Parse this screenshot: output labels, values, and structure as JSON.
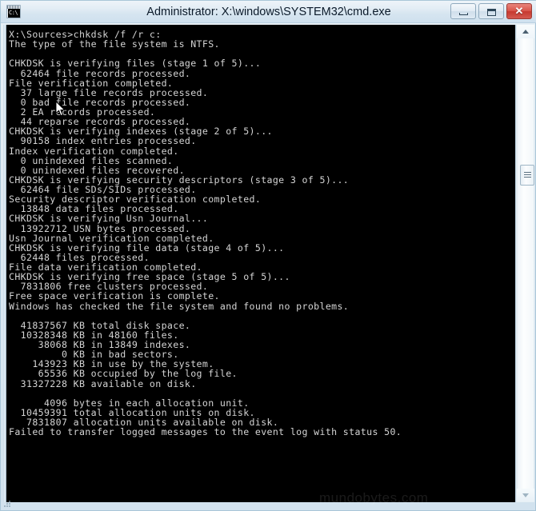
{
  "window": {
    "title": "Administrator: X:\\windows\\SYSTEM32\\cmd.exe",
    "app_icon": "cmd-console-icon",
    "icon_prompt_text": "C:\\",
    "colors": {
      "titlebar_top": "#eef4f9",
      "titlebar_bottom": "#cfe0ee",
      "frame_border": "#a9c6d8",
      "console_background": "#000000",
      "console_foreground": "#d4d4d4",
      "close_button": "#c6392f"
    },
    "caption_buttons": [
      {
        "name": "minimize",
        "label": "Minimize",
        "glyph": "minimize-icon"
      },
      {
        "name": "maximize",
        "label": "Maximize",
        "glyph": "maximize-icon"
      },
      {
        "name": "close",
        "label": "Close",
        "glyph": "close-icon"
      }
    ]
  },
  "scrollbar": {
    "orientation": "vertical",
    "up_arrow": "chevron-up-icon",
    "down_arrow": "chevron-down-icon",
    "thumb_position_percent": 28
  },
  "watermark": {
    "text": "mundobytes.com"
  },
  "console": {
    "prompt": "X:\\Sources>",
    "command": "chkdsk /f /r c:",
    "full_text": "X:\\Sources>chkdsk /f /r c:\nThe type of the file system is NTFS.\n\nCHKDSK is verifying files (stage 1 of 5)...\n  62464 file records processed.\nFile verification completed.\n  37 large file records processed.\n  0 bad file records processed.\n  2 EA records processed.\n  44 reparse records processed.\nCHKDSK is verifying indexes (stage 2 of 5)...\n  90158 index entries processed.\nIndex verification completed.\n  0 unindexed files scanned.\n  0 unindexed files recovered.\nCHKDSK is verifying security descriptors (stage 3 of 5)...\n  62464 file SDs/SIDs processed.\nSecurity descriptor verification completed.\n  13848 data files processed.\nCHKDSK is verifying Usn Journal...\n  13922712 USN bytes processed.\nUsn Journal verification completed.\nCHKDSK is verifying file data (stage 4 of 5)...\n  62448 files processed.\nFile data verification completed.\nCHKDSK is verifying free space (stage 5 of 5)...\n  7831806 free clusters processed.\nFree space verification is complete.\nWindows has checked the file system and found no problems.\n\n  41837567 KB total disk space.\n  10328348 KB in 48160 files.\n     38068 KB in 13849 indexes.\n         0 KB in bad sectors.\n    143923 KB in use by the system.\n     65536 KB occupied by the log file.\n  31327228 KB available on disk.\n\n      4096 bytes in each allocation unit.\n  10459391 total allocation units on disk.\n   7831807 allocation units available on disk.\nFailed to transfer logged messages to the event log with status 50.",
    "lines": [
      "X:\\Sources>chkdsk /f /r c:",
      "The type of the file system is NTFS.",
      "",
      "CHKDSK is verifying files (stage 1 of 5)...",
      "  62464 file records processed.",
      "File verification completed.",
      "  37 large file records processed.",
      "  0 bad file records processed.",
      "  2 EA records processed.",
      "  44 reparse records processed.",
      "CHKDSK is verifying indexes (stage 2 of 5)...",
      "  90158 index entries processed.",
      "Index verification completed.",
      "  0 unindexed files scanned.",
      "  0 unindexed files recovered.",
      "CHKDSK is verifying security descriptors (stage 3 of 5)...",
      "  62464 file SDs/SIDs processed.",
      "Security descriptor verification completed.",
      "  13848 data files processed.",
      "CHKDSK is verifying Usn Journal...",
      "  13922712 USN bytes processed.",
      "Usn Journal verification completed.",
      "CHKDSK is verifying file data (stage 4 of 5)...",
      "  62448 files processed.",
      "File data verification completed.",
      "CHKDSK is verifying free space (stage 5 of 5)...",
      "  7831806 free clusters processed.",
      "Free space verification is complete.",
      "Windows has checked the file system and found no problems.",
      "",
      "  41837567 KB total disk space.",
      "  10328348 KB in 48160 files.",
      "     38068 KB in 13849 indexes.",
      "         0 KB in bad sectors.",
      "    143923 KB in use by the system.",
      "     65536 KB occupied by the log file.",
      "  31327228 KB available on disk.",
      "",
      "      4096 bytes in each allocation unit.",
      "  10459391 total allocation units on disk.",
      "   7831807 allocation units available on disk.",
      "Failed to transfer logged messages to the event log with status 50."
    ],
    "summary": {
      "filesystem": "NTFS",
      "total_disk_space_kb": 41837567,
      "in_files_kb": 10328348,
      "file_count": 48160,
      "in_indexes_kb": 38068,
      "index_count": 13849,
      "in_bad_sectors_kb": 0,
      "in_use_by_system_kb": 143923,
      "log_file_kb": 65536,
      "available_kb": 31327228,
      "bytes_per_allocation_unit": 4096,
      "total_allocation_units": 10459391,
      "available_allocation_units": 7831807,
      "result_message": "Windows has checked the file system and found no problems.",
      "error_message": "Failed to transfer logged messages to the event log with status 50."
    }
  }
}
